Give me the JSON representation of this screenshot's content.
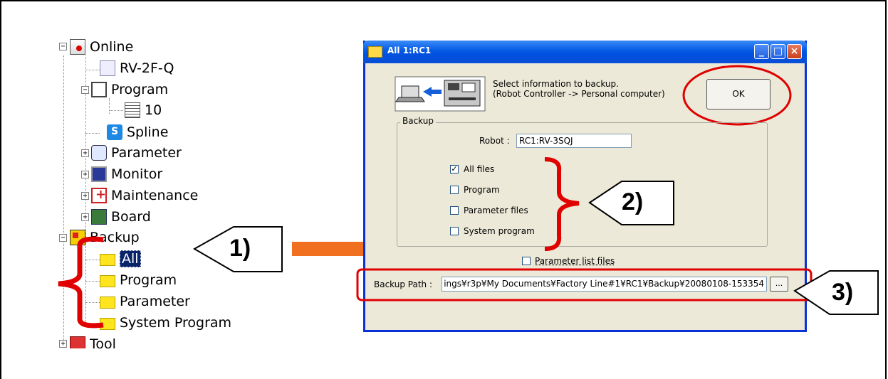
{
  "tree": {
    "items": [
      {
        "label": "Online",
        "icon": "online-icon"
      },
      {
        "label": "RV-2F-Q",
        "icon": "robot-icon"
      },
      {
        "label": "Program",
        "icon": "program-icon"
      },
      {
        "label": "10",
        "icon": "document-icon"
      },
      {
        "label": "Spline",
        "icon": "spline-icon"
      },
      {
        "label": "Parameter",
        "icon": "parameter-icon"
      },
      {
        "label": "Monitor",
        "icon": "monitor-icon"
      },
      {
        "label": "Maintenance",
        "icon": "maintenance-icon"
      },
      {
        "label": "Board",
        "icon": "board-icon"
      },
      {
        "label": "Backup",
        "icon": "backup-icon"
      },
      {
        "label": "All",
        "icon": "folder-icon"
      },
      {
        "label": "Program",
        "icon": "folder-icon"
      },
      {
        "label": "Parameter",
        "icon": "folder-icon"
      },
      {
        "label": "System Program",
        "icon": "folder-icon"
      },
      {
        "label": "Tool",
        "icon": "tool-icon"
      }
    ],
    "expanders": {
      "minus": "−",
      "plus": "+"
    }
  },
  "callouts": {
    "step1": "1)",
    "step2": "2)",
    "step3": "3)"
  },
  "dialog": {
    "title": "All 1:RC1",
    "title_buttons": {
      "minimize": "_",
      "maximize": "□",
      "close": "×"
    },
    "message_line1": "Select information to backup.",
    "message_line2": "(Robot Controller -> Personal computer)",
    "ok_button": "OK",
    "backup_group_label": "Backup",
    "robot_label": "Robot :",
    "robot_value": "RC1:RV-3SQJ",
    "checkboxes": [
      {
        "label": "All files",
        "checked": true
      },
      {
        "label": "Program",
        "checked": false
      },
      {
        "label": "Parameter files",
        "checked": false
      },
      {
        "label": "System program",
        "checked": false
      }
    ],
    "parameter_list": {
      "label": "Parameter list files",
      "checked": false
    },
    "backup_path_label": "Backup Path :",
    "backup_path_value": "ings¥r3p¥My Documents¥Factory Line#1¥RC1¥Backup¥20080108-153354",
    "browse_button": "..."
  },
  "colors": {
    "annotation_red": "#e00000",
    "arrow_orange": "#f07020",
    "xp_blue": "#0a5ee6",
    "dialog_bg": "#ece9d8"
  }
}
